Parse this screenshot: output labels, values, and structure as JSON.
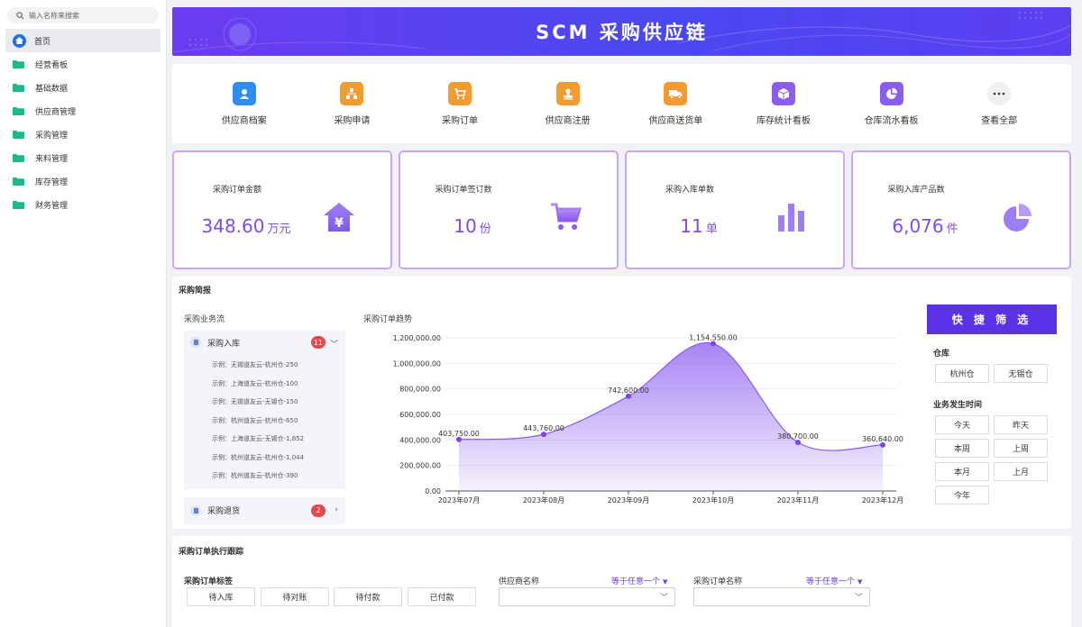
{
  "sidebar": {
    "search_placeholder": "输入名称来搜索",
    "items": [
      {
        "label": "首页"
      },
      {
        "label": "经营看板"
      },
      {
        "label": "基础数据"
      },
      {
        "label": "供应商管理"
      },
      {
        "label": "采购管理"
      },
      {
        "label": "来料管理"
      },
      {
        "label": "库存管理"
      },
      {
        "label": "财务管理"
      }
    ]
  },
  "banner": {
    "title": "SCM 采购供应链"
  },
  "quick_links": [
    {
      "label": "供应商档案",
      "icon": "user-card-icon",
      "color": "#2f8cf0"
    },
    {
      "label": "采购申请",
      "icon": "org-chart-icon",
      "color": "#f39b2f"
    },
    {
      "label": "采购订单",
      "icon": "cart-icon",
      "color": "#f39b2f"
    },
    {
      "label": "供应商注册",
      "icon": "stamp-icon",
      "color": "#f39b2f"
    },
    {
      "label": "供应商送货单",
      "icon": "truck-icon",
      "color": "#f39b2f"
    },
    {
      "label": "库存统计看板",
      "icon": "box-icon",
      "color": "#8a5cf0"
    },
    {
      "label": "仓库流水看板",
      "icon": "pie-icon",
      "color": "#8a5cf0"
    },
    {
      "label": "查看全部",
      "icon": "more-icon",
      "color": "#f0f0f2"
    }
  ],
  "stats": [
    {
      "title": "采购订单金额",
      "value": "348.60",
      "unit": "万元",
      "icon": "yuan-house-icon"
    },
    {
      "title": "采购订单签订数",
      "value": "10",
      "unit": "份",
      "icon": "cart-icon"
    },
    {
      "title": "采购入库单数",
      "value": "11",
      "unit": "单",
      "icon": "bar-chart-icon"
    },
    {
      "title": "采购入库产品数",
      "value": "6,076",
      "unit": "件",
      "icon": "pie-chart-icon"
    }
  ],
  "brief": {
    "title": "采购简报",
    "flow_title": "采购业务流",
    "inbound": {
      "label": "采购入库",
      "count": "11",
      "rows": [
        "示例：无锡道友云-杭州仓-250",
        "示例：上海道友云-杭州仓-100",
        "示例：无锡道友云-无锡仓-150",
        "示例：杭州道友云-杭州仓-650",
        "示例：上海道友云-无锡仓-1,852",
        "示例：杭州道友云-杭州仓-1,044",
        "示例：杭州道友云-杭州仓-390"
      ]
    },
    "returns": {
      "label": "采购退货",
      "count": "2"
    },
    "trend_title": "采购订单趋势",
    "filter": {
      "button": "快 捷 筛 选",
      "warehouse_label": "仓库",
      "warehouses": [
        "杭州仓",
        "无锡仓"
      ],
      "time_label": "业务发生时间",
      "times": [
        "今天",
        "昨天",
        "本周",
        "上周",
        "本月",
        "上月",
        "今年"
      ]
    }
  },
  "chart_data": {
    "type": "area",
    "title": "采购订单趋势",
    "categories": [
      "2023年07月",
      "2023年08月",
      "2023年09月",
      "2023年10月",
      "2023年11月",
      "2023年12月"
    ],
    "values": [
      403750,
      443760,
      742600,
      1154550,
      380700,
      360640
    ],
    "data_labels": [
      "403,750.00",
      "443,760.00",
      "742,600.00",
      "1,154,550.00",
      "380,700.00",
      "360,640.00"
    ],
    "yticks": [
      "0.00",
      "200,000.00",
      "400,000.00",
      "600,000.00",
      "800,000.00",
      "1,000,000.00",
      "1,200,000.00"
    ],
    "ylim": [
      0,
      1200000
    ],
    "color": "#8a5cf0",
    "grid": true
  },
  "track": {
    "title": "采购订单执行跟踪",
    "tag_label": "采购订单标签",
    "tags": [
      "待入库",
      "待对账",
      "待付款",
      "已付款"
    ],
    "supplier_label": "供应商名称",
    "supplier_mode": "等于任意一个",
    "order_label": "采购订单名称",
    "order_mode": "等于任意一个"
  }
}
